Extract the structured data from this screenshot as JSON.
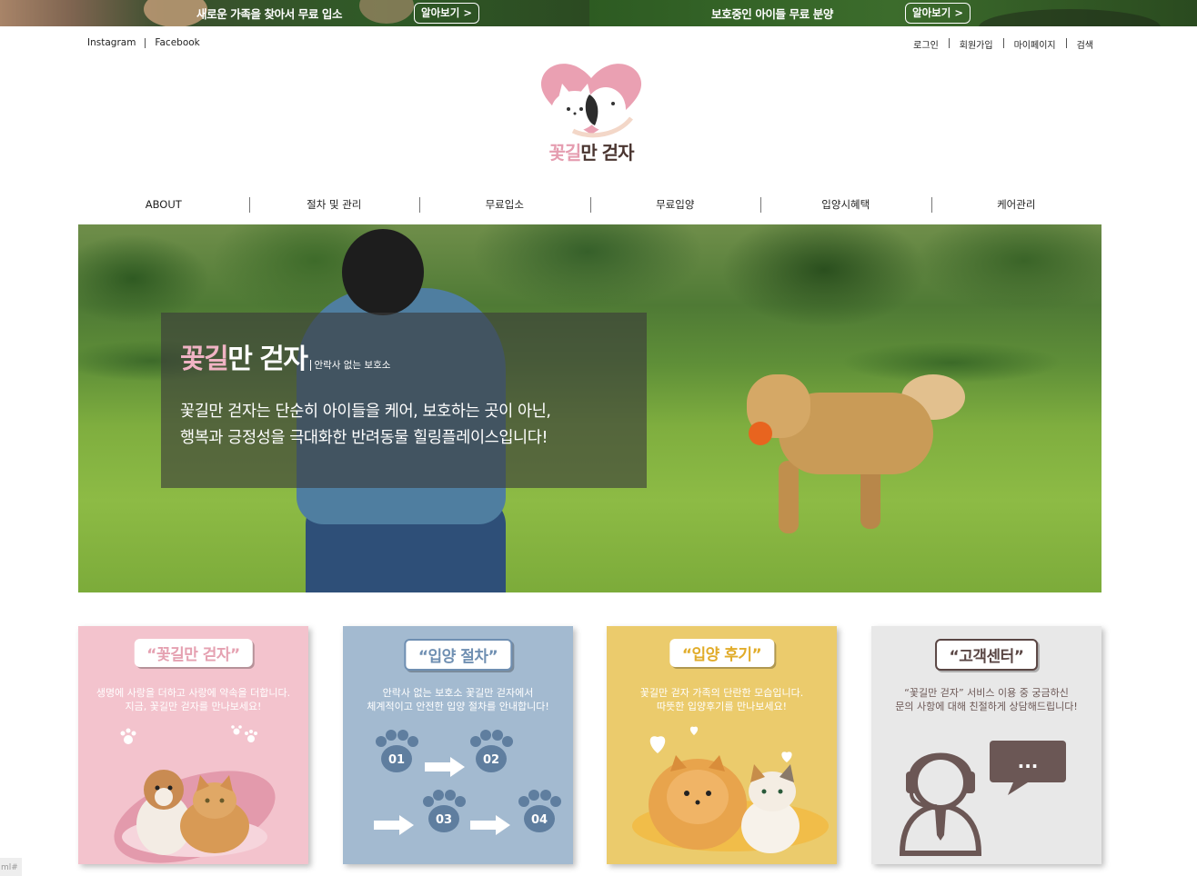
{
  "promo": {
    "left_text": "새로운 가족을 찾아서 무료 입소",
    "left_button": "알아보기 >",
    "right_text": "보호중인 아이들 무료 분양",
    "right_button": "알아보기 >"
  },
  "util": {
    "left": [
      "Instagram",
      "Facebook"
    ],
    "right": [
      "로그인",
      "회원가입",
      "마이페이지",
      "검색"
    ]
  },
  "logo": {
    "part1": "꽃길",
    "part2": "만 걷자"
  },
  "nav": [
    "ABOUT",
    "절차 및 관리",
    "무료입소",
    "무료입양",
    "입양시혜택",
    "케어관리"
  ],
  "hero": {
    "title_pink": "꽃길",
    "title_white": "만 걷자",
    "subtitle": "안락사 없는 보호소",
    "desc_line1": "꽃길만 걷자는 단순히 아이들을 케어, 보호하는 곳이 아닌,",
    "desc_line2": "행복과 긍정성을 극대화한 반려동물 힐링플레이스입니다!"
  },
  "cards": [
    {
      "title": "“꽃길만 걷자”",
      "line1": "생명에 사랑을 더하고 사랑에 약속을 더합니다.",
      "line2": "지금, 꽃길만 걷자를 만나보세요!"
    },
    {
      "title": "“입양 절차”",
      "line1": "안락사 없는 보호소 꽃길만 걷자에서",
      "line2": "체계적이고 안전한 입양 절차를 안내합니다!",
      "steps": [
        "01",
        "02",
        "03",
        "04"
      ]
    },
    {
      "title": "“입양 후기”",
      "line1": "꽃길만 걷자 가족의 단란한 모습입니다.",
      "line2": "따뜻한 입양후기를 만나보세요!"
    },
    {
      "title": "“고객센터”",
      "line1": "“꽃길만 걷자” 서비스 이용 중 궁금하신",
      "line2": "문의 사항에 대해 친절하게 상담해드립니다!",
      "bubble": "..."
    }
  ],
  "side_tab": "ml#",
  "colors": {
    "pink": "#f3c3cd",
    "blue": "#a3bad0",
    "yellow": "#ebcb6c",
    "gray": "#e8e8e8",
    "brown": "#6b5755"
  }
}
